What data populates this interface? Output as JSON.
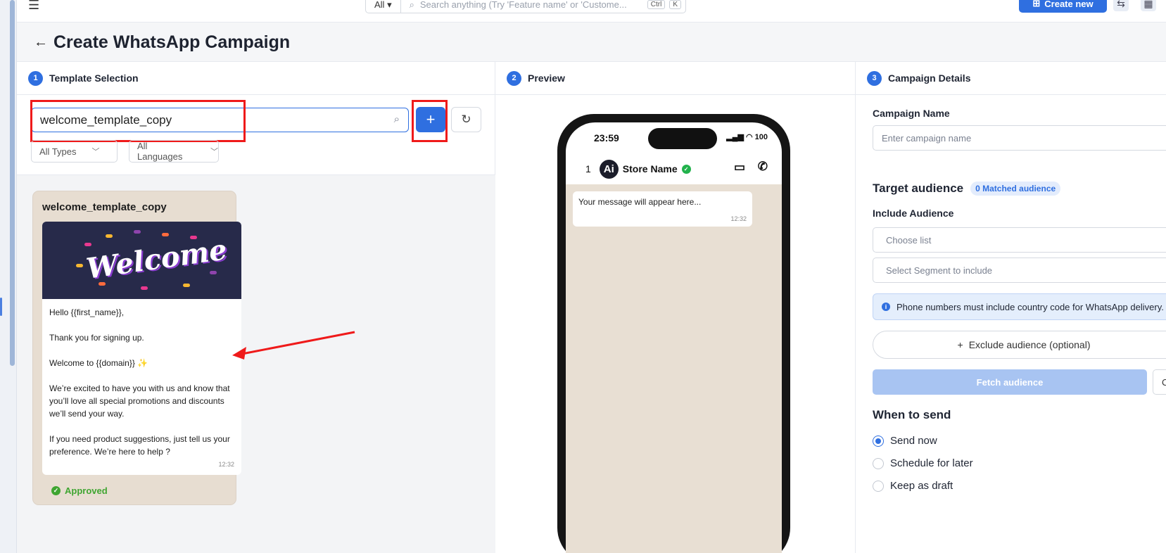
{
  "topbar": {
    "search_scope": "All",
    "search_placeholder": "Search anything (Try 'Feature name' or 'Custome...",
    "kbd_ctrl": "Ctrl",
    "kbd_k": "K",
    "create_new_label": "Create new"
  },
  "page": {
    "title": "Create WhatsApp Campaign"
  },
  "template_section": {
    "step": "1",
    "heading": "Template Selection",
    "search_value": "welcome_template_copy",
    "filter_types": "All Types",
    "filter_languages": "All Languages",
    "card": {
      "name": "welcome_template_copy",
      "image_word": "Welcome",
      "line1": "Hello {{first_name}},",
      "line2": "Thank you for signing up.",
      "line3": "Welcome to {{domain}} ✨",
      "line4": "We’re excited to have you with us and know that you’ll love all special promotions and discounts we’ll send your way.",
      "line5": "If you need product suggestions, just tell us your preference. We’re here to help ?",
      "time": "12:32",
      "status": "Approved"
    }
  },
  "preview_section": {
    "step": "2",
    "heading": "Preview",
    "phone": {
      "time": "23:59",
      "battery": "100",
      "chat_count": "1",
      "avatar_text": "Ai",
      "store_name": "Store Name",
      "bubble_text": "Your message will appear here...",
      "bubble_time": "12:32"
    }
  },
  "details_section": {
    "step": "3",
    "heading": "Campaign Details",
    "campaign_name_label": "Campaign Name",
    "campaign_name_placeholder": "Enter campaign name",
    "target_audience_label": "Target audience",
    "matched_badge": "0 Matched audience",
    "include_label": "Include Audience",
    "choose_list_placeholder": "Choose list",
    "segment_placeholder": "Select Segment to include",
    "info_text": "Phone numbers must include country code for WhatsApp delivery.",
    "exclude_label": "Exclude audience (optional)",
    "fetch_label": "Fetch audience",
    "fetch2_label": "C",
    "when_to_send_label": "When to send",
    "options": [
      "Send now",
      "Schedule for later",
      "Keep as draft"
    ],
    "selected_option": "Send now"
  },
  "colors": {
    "accent": "#2f6fe0",
    "annotation_red": "#ef1a1a",
    "approved_green": "#3fa531"
  }
}
